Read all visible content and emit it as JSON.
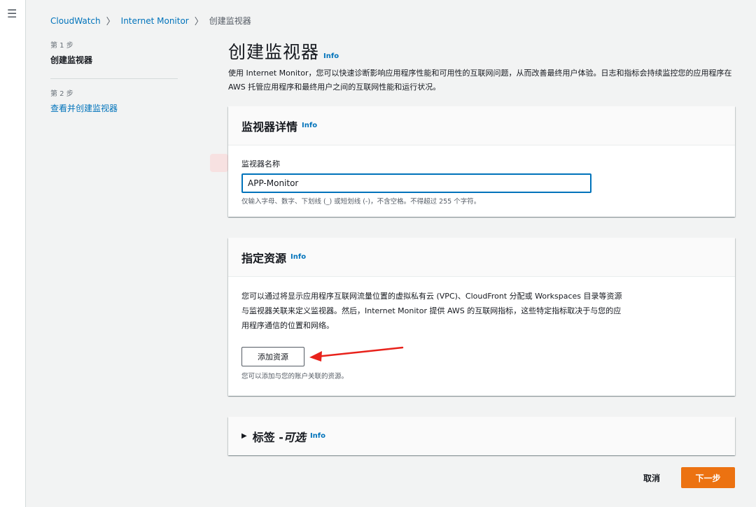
{
  "breadcrumb": [
    "CloudWatch",
    "Internet Monitor",
    "创建监视器"
  ],
  "steps": [
    {
      "num": "第 1 步",
      "title": "创建监视器"
    },
    {
      "num": "第 2 步",
      "title": "查看并创建监视器"
    }
  ],
  "page": {
    "title": "创建监视器",
    "info": "Info",
    "description": "使用 Internet Monitor，您可以快速诊断影响应用程序性能和可用性的互联网问题，从而改善最终用户体验。日志和指标会持续监控您的应用程序在 AWS 托管应用程序和最终用户之间的互联网性能和运行状况。"
  },
  "details_card": {
    "title": "监视器详情",
    "info": "Info",
    "field_label": "监视器名称",
    "field_value": "APP-Monitor",
    "field_hint": "仅输入字母、数字、下划线 (_) 或短划线 (-)，不含空格。不得超过 255 个字符。"
  },
  "resources_card": {
    "title": "指定资源",
    "info": "Info",
    "description": "您可以通过将显示应用程序互联网流量位置的虚拟私有云 (VPC)、CloudFront 分配或 Workspaces 目录等资源与监视器关联来定义监视器。然后，Internet Monitor 提供 AWS 的互联网指标，这些特定指标取决于与您的应用程序通信的位置和网络。",
    "button": "添加资源",
    "button_hint": "您可以添加与您的账户关联的资源。"
  },
  "tags_card": {
    "title": "标签 - ",
    "optional": "可选",
    "info": "Info"
  },
  "footer": {
    "cancel": "取消",
    "next": "下一步"
  },
  "colors": {
    "link": "#0073bb",
    "primary": "#ec7211",
    "annotation_arrow": "#e8221b"
  },
  "icons": {
    "menu": "hamburger-icon",
    "separator": "chevron-right-icon",
    "expand": "caret-right-icon"
  }
}
